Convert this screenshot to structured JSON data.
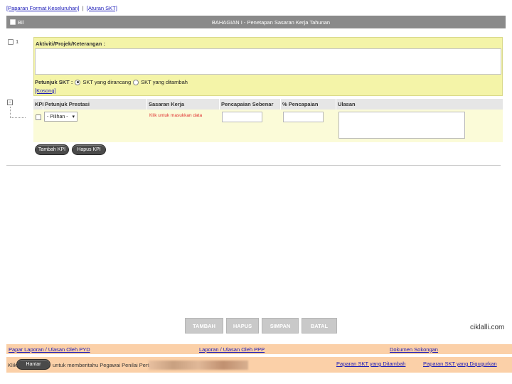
{
  "top_links": {
    "format": "[Paparan Format Keseluruhan]",
    "aturan": "[Aturan SKT]"
  },
  "header": {
    "bil": "Bil",
    "title": "BAHAGIAN I - Penetapan Sasaran Kerja Tahunan"
  },
  "row": {
    "number": "1",
    "aktiviti_label": "Aktiviti/Projek/Keterangan :",
    "petunjuk_label": "Petunjuk SKT :",
    "radio_dirancang": "SKT yang dirancang",
    "radio_ditambah": "SKT yang ditambah",
    "kosong": "[Kosong]"
  },
  "kpi_table": {
    "headers": [
      "KPI",
      "Petunjuk Prestasi",
      "Sasaran Kerja",
      "Pencapaian Sebenar",
      "% Pencapaian",
      "Ulasan"
    ],
    "select_value": "- Pilihan -",
    "klik_text": "Klik untuk masukkan data"
  },
  "kpi_buttons": {
    "tambah": "Tambah KPI",
    "hapus": "Hapus KPI"
  },
  "action_buttons": {
    "tambah": "TAMBAH",
    "hapus": "HAPUS",
    "simpan": "SIMPAN",
    "batal": "BATAL"
  },
  "watermark": "ciklalli.com",
  "footer": {
    "link1": "Papar Laporan / Ulasan Oleh PYD",
    "link2": "Laporan / Ulasan Oleh PPP",
    "link3": "Dokumen Sokongan",
    "klik": "Klik",
    "hantar": "Hantar",
    "untuk": "untuk memberitahu Pegawai Penilai Pertama",
    "link4": "Paparan SKT yang Ditambah",
    "link5": "Paparan SKT yang Digugurkan"
  },
  "colors": {
    "header_gray": "#8a8a8a",
    "yellow": "#f4f4a8",
    "footer_peach": "#fbd0a8",
    "link_blue": "#1a1ab8"
  }
}
